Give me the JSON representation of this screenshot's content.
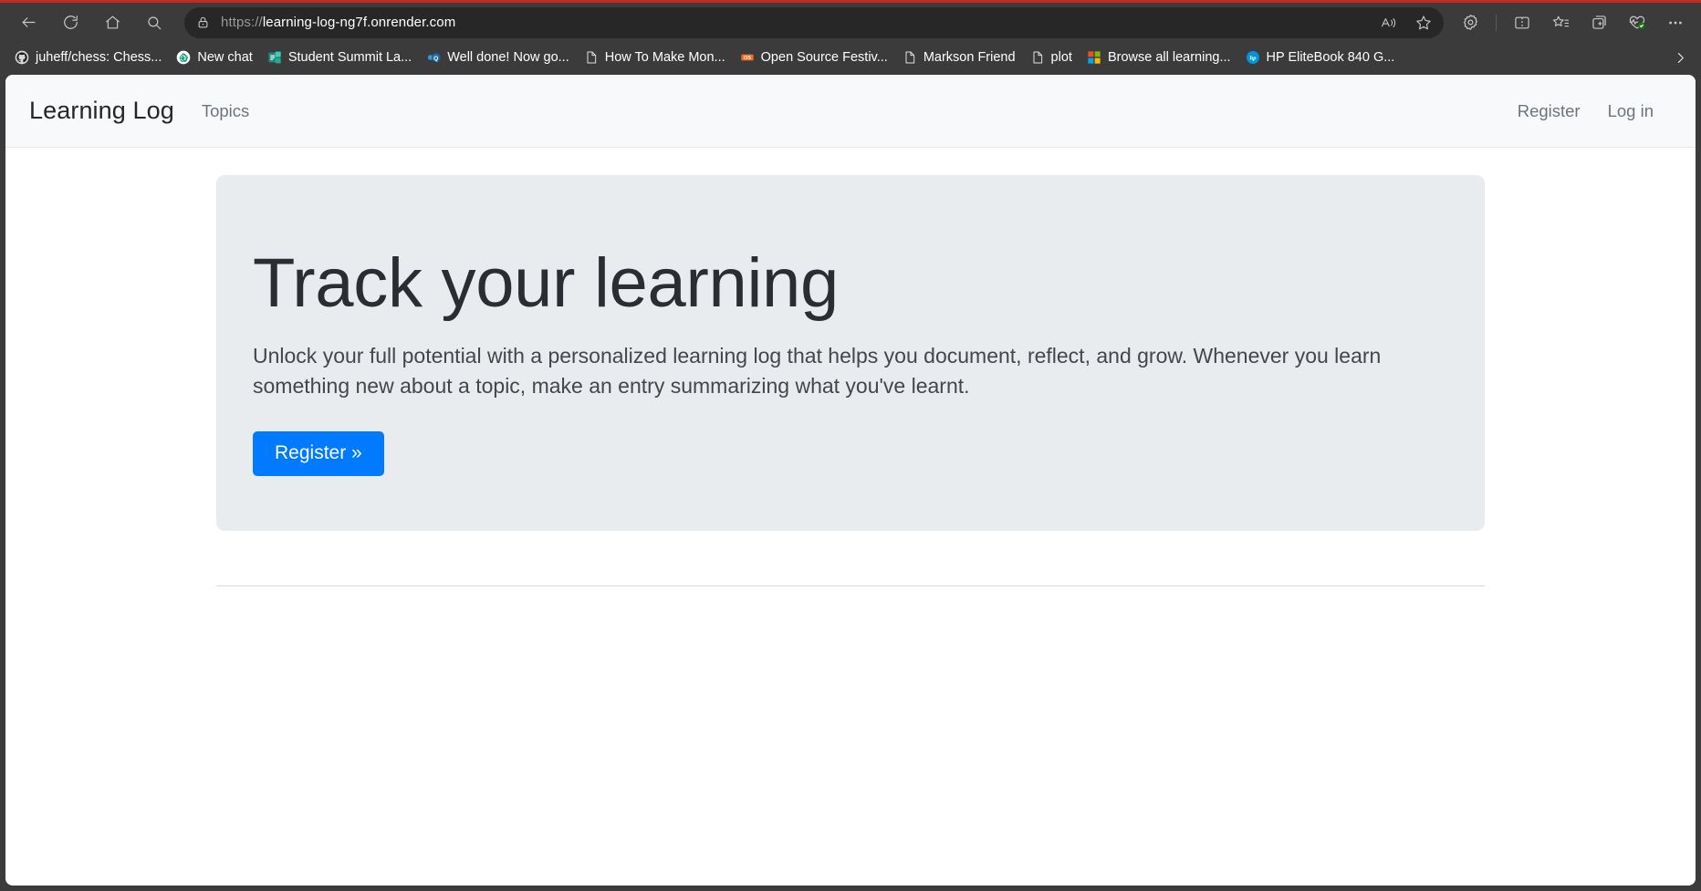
{
  "browser": {
    "toolbar": {
      "back_label": "Back",
      "refresh_label": "Refresh",
      "home_label": "Home",
      "search_label": "Search",
      "url": "https://learning-log-ng7f.onrender.com",
      "url_scheme": "https://",
      "url_rest": "learning-log-ng7f.onrender.com",
      "site_info_label": "View site information",
      "read_aloud_label": "Read this page aloud",
      "favorite_label": "Add this page to favorites",
      "extensions_label": "Extensions",
      "split_screen_label": "Split screen",
      "favorites_label": "Favorites",
      "collections_label": "Collections",
      "browser_essentials_label": "Browser essentials",
      "settings_more_label": "Settings and more"
    },
    "bookmarks": {
      "overflow_label": "Show more bookmarks",
      "items": [
        {
          "label": "juheff/chess: Chess...",
          "icon": "github-icon"
        },
        {
          "label": "New chat",
          "icon": "openai-icon"
        },
        {
          "label": "Student Summit La...",
          "icon": "sharepoint-icon"
        },
        {
          "label": "Well done! Now go...",
          "icon": "quiz-icon"
        },
        {
          "label": "How To Make Mon...",
          "icon": "document-icon"
        },
        {
          "label": "Open Source Festiv...",
          "icon": "os-badge-icon"
        },
        {
          "label": "Markson Friend",
          "icon": "document-icon"
        },
        {
          "label": "plot",
          "icon": "document-icon"
        },
        {
          "label": "Browse all learning...",
          "icon": "microsoft-icon"
        },
        {
          "label": "HP EliteBook 840 G...",
          "icon": "hp-icon"
        }
      ]
    }
  },
  "site": {
    "brand": "Learning Log",
    "nav_links": [
      {
        "label": "Topics"
      }
    ],
    "auth_links": [
      {
        "label": "Register"
      },
      {
        "label": "Log in"
      }
    ],
    "hero": {
      "title": "Track your learning",
      "lead": "Unlock your full potential with a personalized learning log that helps you document, reflect, and grow. Whenever you learn something new about a topic, make an entry summarizing what you've learnt.",
      "cta_label": "Register »"
    }
  },
  "colors": {
    "accent": "#007bff",
    "chrome": "#3b3b3b",
    "addressbar": "#272727",
    "navbar_bg": "#f8f9fa",
    "jumbotron_bg": "#e9ecef",
    "top_accent": "#c42b1c"
  }
}
